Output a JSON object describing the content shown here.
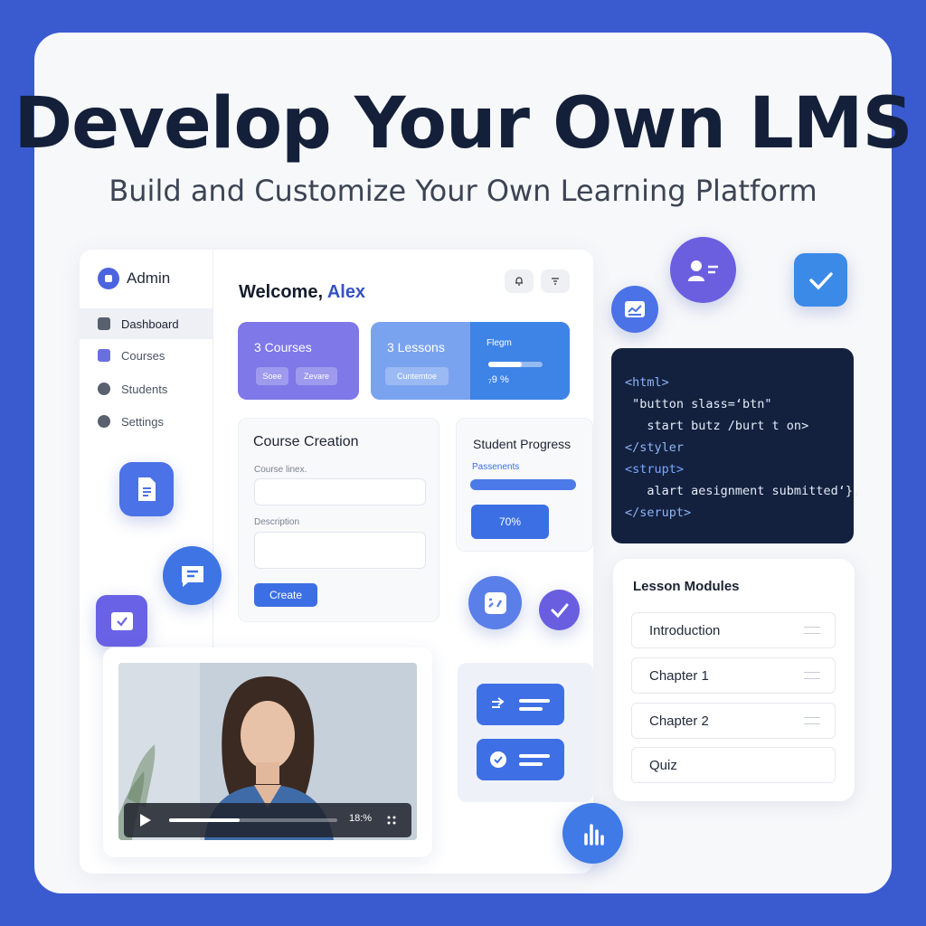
{
  "headline": "Develop Your Own LMS",
  "subheadline": "Build and Customize Your Own Learning Platform",
  "sidebar": {
    "brand": "Admin",
    "items": [
      {
        "label": "Dashboard",
        "icon": "image-icon"
      },
      {
        "label": "Courses",
        "icon": "book-icon"
      },
      {
        "label": "Students",
        "icon": "user-icon"
      },
      {
        "label": "Settings",
        "icon": "gear-icon"
      }
    ]
  },
  "header": {
    "welcome_prefix": "Welcome, ",
    "user_name": "Alex",
    "icons": [
      "bell-icon",
      "filter-icon"
    ]
  },
  "stats": {
    "courses": {
      "title": "3 Courses",
      "chip1": "Soee",
      "chip2": "Zevare"
    },
    "lessons": {
      "title": "3 Lessons",
      "chip": "Cuntemtoe"
    },
    "progress": {
      "title": "Flegm",
      "value": "₇9 %",
      "fill": 0.62
    }
  },
  "course_creation": {
    "title": "Course Creation",
    "course_label": "Course linex.",
    "description_label": "Description",
    "create_label": "Create"
  },
  "student_progress": {
    "title": "Student Progress",
    "subtitle": "Passenents",
    "bar_fill": 1.0,
    "percent": "70%"
  },
  "code": {
    "lines": [
      "<html>",
      " \"button slass=‘btn\"",
      "   start butz /burt t on>",
      "</styler",
      "<strupt>",
      "   alart aesignment submitted‘},",
      "</serupt>"
    ]
  },
  "lesson_modules": {
    "title": "Lesson Modules",
    "items": [
      "Introduction",
      "Chapter 1",
      "Chapter 2",
      "Quiz"
    ]
  },
  "video": {
    "time": "18:%",
    "progress": 0.42
  },
  "colors": {
    "background": "#3a5bd0",
    "primary": "#3c6fe3",
    "purple": "#7e78e8",
    "code_bg": "#13213f"
  }
}
